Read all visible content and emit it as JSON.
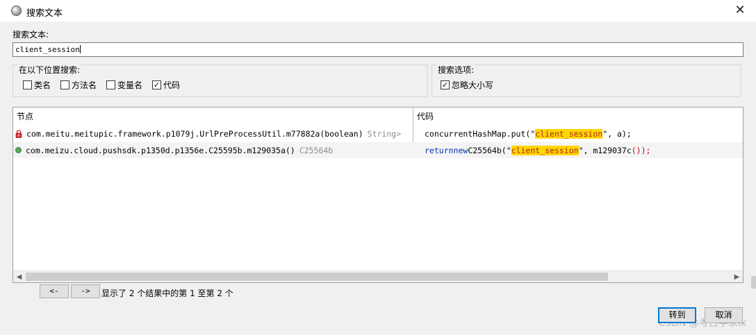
{
  "window": {
    "title": "搜索文本",
    "close_glyph": "✕"
  },
  "search": {
    "label": "搜索文本:",
    "value": "client_session"
  },
  "location_group": {
    "title": "在以下位置搜索:",
    "options": [
      {
        "label": "类名",
        "checked": false
      },
      {
        "label": "方法名",
        "checked": false
      },
      {
        "label": "变量名",
        "checked": false
      },
      {
        "label": "代码",
        "checked": true
      }
    ]
  },
  "options_group": {
    "title": "搜索选项:",
    "options": [
      {
        "label": "忽略大小写",
        "checked": true
      }
    ]
  },
  "results": {
    "columns": [
      "节点",
      "代码"
    ],
    "rows": [
      {
        "node_icon": "locked-method-icon",
        "node": "com.meitu.meitupic.framework.p1079j.UrlPreProcessUtil.m77882a(boolean)",
        "node_type": "String>",
        "code_before": "concurrentHashMap.put(\"",
        "code_match": "client_session",
        "code_after": "\", a);"
      },
      {
        "node_icon": "public-method-icon",
        "node": "com.meizu.cloud.pushsdk.p1350d.p1356e.C25595b.m129035a()",
        "node_type": "C25564b",
        "code_kw1": "return",
        "code_kw2": "new",
        "code_before": "C25564b(\"",
        "code_match": "client_session",
        "code_after": "\", m129037c",
        "code_parens": "());"
      }
    ]
  },
  "navigation": {
    "prev_label": "<-",
    "next_label": "->",
    "status": "显示了 2 个结果中的第 1 至第 2 个"
  },
  "buttons": {
    "goto_label": "转到",
    "cancel_label": "取消"
  },
  "watermark": "CSDN @考古学家lx",
  "colors": {
    "highlight": "#ffd700",
    "keyword": "#0033b3",
    "accent": "#0078d7"
  }
}
